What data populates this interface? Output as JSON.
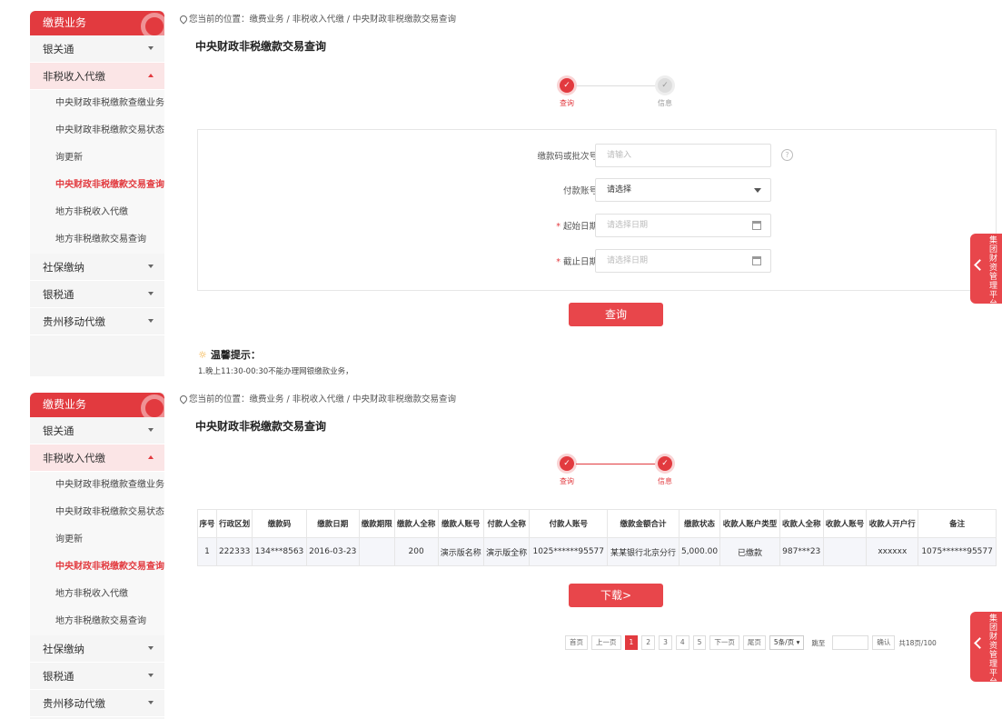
{
  "sidebar": {
    "header": "缴费业务",
    "items": [
      {
        "label": "银关通",
        "expanded": false
      },
      {
        "label": "非税收入代缴",
        "expanded": true
      },
      {
        "label": "社保缴纳",
        "expanded": false
      },
      {
        "label": "银税通",
        "expanded": false
      },
      {
        "label": "贵州移动代缴",
        "expanded": false
      }
    ],
    "subitems": [
      "中央财政非税缴款查缴业务",
      "中央财政非税缴款交易状态查",
      "询更新",
      "中央财政非税缴款交易查询",
      "地方非税收入代缴",
      "地方非税缴款交易查询"
    ],
    "active_subitem": "中央财政非税缴款交易查询"
  },
  "breadcrumb": "您当前的位置：缴费业务 / 非税收入代缴 / 中央财政非税缴款交易查询",
  "page_title": "中央财政非税缴款交易查询",
  "steps": {
    "step1": "查询",
    "step2": "信息",
    "check_glyph": "✓"
  },
  "form": {
    "code_label": "缴款码或批次号",
    "code_placeholder": "请输入",
    "help_glyph": "?",
    "account_label": "付款账号",
    "account_value": "请选择",
    "required_mark": "*",
    "start_label": "起始日期",
    "start_placeholder": "请选择日期",
    "end_label": "截止日期",
    "end_placeholder": "请选择日期",
    "query_button": "查询"
  },
  "tips": {
    "icon": "☼",
    "title": "温馨提示：",
    "line1": "1.晚上11:30-00:30不能办理网银缴款业务，"
  },
  "side_tab": "集团财资管理平台",
  "table": {
    "headers": [
      "序号",
      "行政区划",
      "缴款码",
      "缴款日期",
      "缴款期限",
      "缴款人全称",
      "缴款人账号",
      "付款人全称",
      "付款人账号",
      "缴款金额合计",
      "缴款状态",
      "收款人账户类型",
      "收款人全称",
      "收款人账号",
      "收款人开户行",
      "备注"
    ],
    "rows": [
      [
        "1",
        "222333",
        "134***8563",
        "2016-03-23",
        "",
        "200",
        "演示版名称",
        "演示版全称",
        "1025******95577",
        "某某银行北京分行",
        "5,000.00",
        "已缴款",
        "987***23",
        "",
        "xxxxxx",
        "1075******95577"
      ]
    ]
  },
  "download_button": "下载>",
  "pager": {
    "first": "首页",
    "prev": "上一页",
    "pages": [
      "1",
      "2",
      "3",
      "4",
      "5"
    ],
    "current": "1",
    "next": "下一页",
    "last": "尾页",
    "page_size": "5条/页",
    "goto_label": "跳至",
    "confirm": "确认",
    "total": "共18页/100"
  }
}
